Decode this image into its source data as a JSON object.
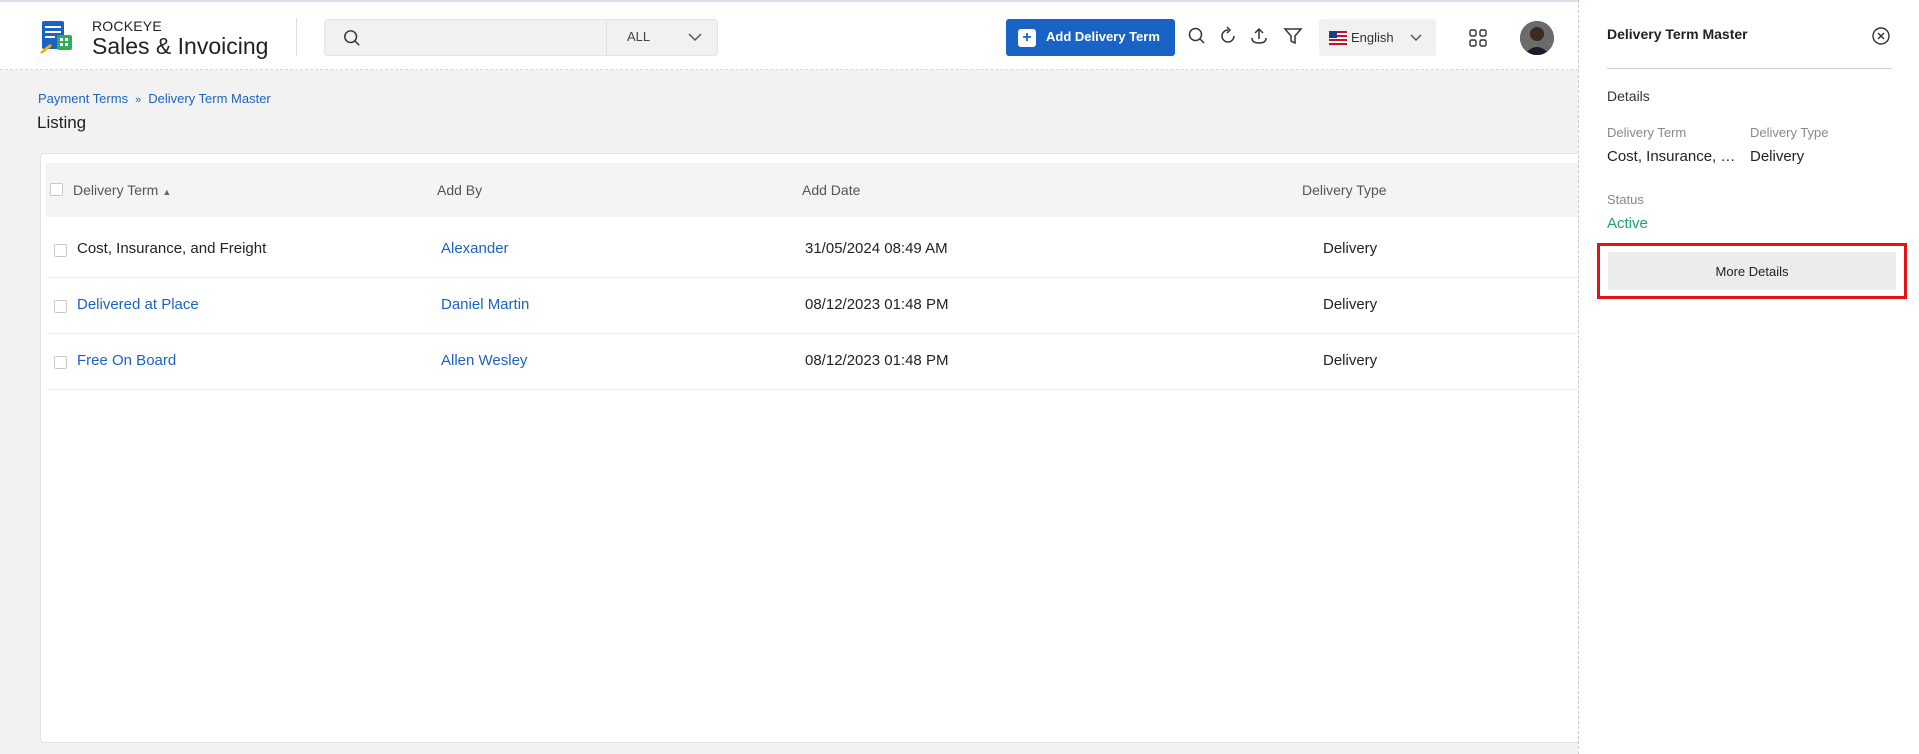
{
  "header": {
    "brand_top": "ROCKEYE",
    "brand_main": "Sales & Invoicing",
    "search_placeholder": "",
    "search_scope": "ALL",
    "add_button_label": "Add Delivery Term",
    "language": "English"
  },
  "breadcrumb": {
    "items": [
      "Payment Terms",
      "Delivery Term Master"
    ]
  },
  "page_title": "Listing",
  "table": {
    "columns": [
      "Delivery Term",
      "Add By",
      "Add Date",
      "Delivery Type"
    ],
    "rows": [
      {
        "term": "Cost, Insurance, and Freight",
        "add_by": "Alexander",
        "add_date": "31/05/2024 08:49 AM",
        "type": "Delivery"
      },
      {
        "term": "Delivered at Place",
        "add_by": "Daniel Martin",
        "add_date": "08/12/2023 01:48 PM",
        "type": "Delivery"
      },
      {
        "term": "Free On Board",
        "add_by": "Allen Wesley",
        "add_date": "08/12/2023 01:48 PM",
        "type": "Delivery"
      }
    ]
  },
  "panel": {
    "title": "Delivery Term Master",
    "section": "Details",
    "delivery_term_label": "Delivery Term",
    "delivery_term_value": "Cost, Insurance, and Freight",
    "delivery_type_label": "Delivery Type",
    "delivery_type_value": "Delivery",
    "status_label": "Status",
    "status_value": "Active",
    "more_button": "More Details"
  },
  "colors": {
    "accent": "#1a63c6",
    "active": "#1ea36a",
    "highlight": "#e41212"
  }
}
